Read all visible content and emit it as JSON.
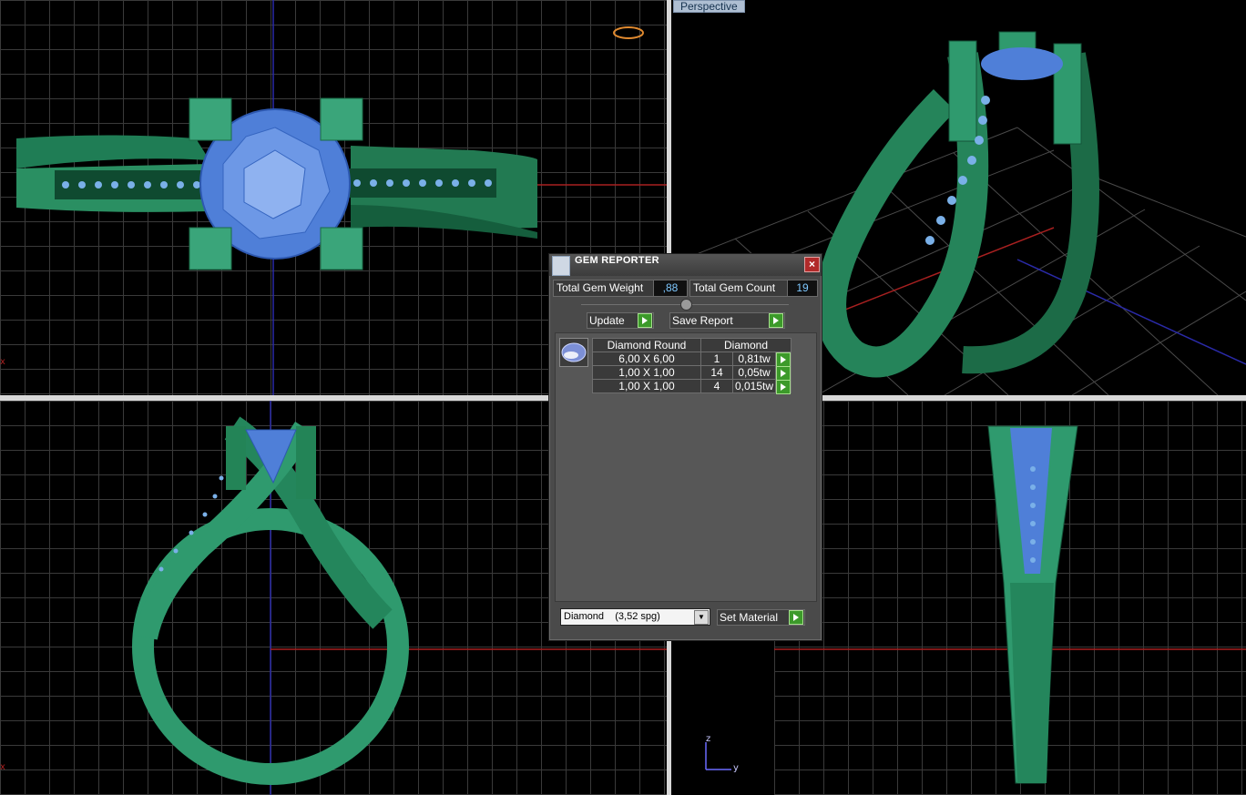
{
  "viewports": {
    "perspective_label": "Perspective",
    "axis_z": "z",
    "axis_y": "y",
    "axis_x": "x"
  },
  "colors": {
    "ring_green": "#2f9a6e",
    "gem_blue": "#4f7fd8",
    "grid": "#3a3a3a",
    "accent_red": "#c0392b",
    "axis_blue": "#2a2aa8"
  },
  "dialog": {
    "title": "GEM REPORTER",
    "close_icon": "close-icon",
    "total_weight_label": "Total Gem Weight",
    "total_weight_value": ",88",
    "total_count_label": "Total Gem Count",
    "total_count_value": "19",
    "update_label": "Update",
    "save_label": "Save Report",
    "table": {
      "header_name": "Diamond Round",
      "header_material": "Diamond",
      "rows": [
        {
          "size": "6,00 X 6,00",
          "count": "1",
          "weight": "0,81tw"
        },
        {
          "size": "1,00 X 1,00",
          "count": "14",
          "weight": "0,05tw"
        },
        {
          "size": "1,00 X 1,00",
          "count": "4",
          "weight": "0,015tw"
        }
      ]
    },
    "material_select": "Diamond    (3,52 spg)",
    "set_material_label": "Set Material"
  }
}
